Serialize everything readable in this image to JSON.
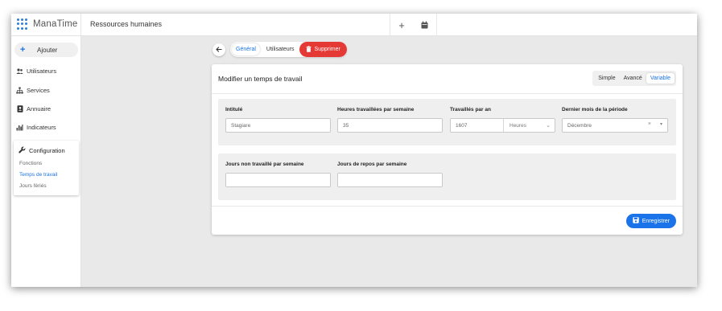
{
  "app": {
    "logo_text": "ManaTime",
    "section_title": "Ressources humaines"
  },
  "topbar": {
    "add_icon": "+",
    "calendar_icon": "calendar-icon"
  },
  "sidebar": {
    "add_label": "Ajouter",
    "items": [
      {
        "label": "Utilisateurs",
        "icon": "users-icon"
      },
      {
        "label": "Services",
        "icon": "org-chart-icon"
      },
      {
        "label": "Annuaire",
        "icon": "address-book-icon"
      },
      {
        "label": "Indicateurs",
        "icon": "bar-chart-icon"
      }
    ],
    "config": {
      "label": "Configuration",
      "subitems": [
        "Fonctions",
        "Temps de travail",
        "Jours fériés"
      ],
      "active": "Temps de travail"
    }
  },
  "tabs": {
    "general": "Général",
    "users": "Utilisateurs",
    "delete": "Supprimer",
    "active": "Général"
  },
  "card": {
    "title": "Modifier un temps de travail",
    "modes": [
      "Simple",
      "Avancé",
      "Variable"
    ],
    "active_mode": "Variable",
    "fields": {
      "intitule_label": "Intitulé",
      "intitule_value": "Stagiare",
      "heures_label": "Heures travaillées par semaine",
      "heures_value": "35",
      "travailles_label": "Travaillés par an",
      "travailles_value": "1607",
      "travailles_unit": "Heures",
      "dernier_mois_label": "Dernier mois de la période",
      "dernier_mois_value": "Décembre",
      "jours_non_label": "Jours non travaillé par semaine",
      "jours_non_value": "",
      "jours_repos_label": "Jours de repos par semaine",
      "jours_repos_value": ""
    },
    "save_label": "Enregistrer"
  },
  "colors": {
    "accent": "#1a73e8",
    "danger": "#e53935"
  }
}
